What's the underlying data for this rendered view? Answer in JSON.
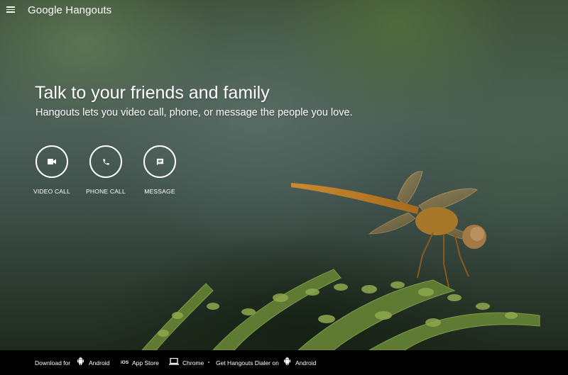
{
  "header": {
    "logo_google": "Google",
    "logo_product": "Hangouts"
  },
  "hero": {
    "title": "Talk to your friends and family",
    "subtitle": "Hangouts lets you video call, phone, or message the people you love."
  },
  "actions": [
    {
      "label": "VIDEO CALL",
      "icon": "videocam-icon"
    },
    {
      "label": "PHONE CALL",
      "icon": "phone-icon"
    },
    {
      "label": "MESSAGE",
      "icon": "message-icon"
    }
  ],
  "footer": {
    "download_for": "Download for",
    "android_label": "Android",
    "ios_badge": "iOS",
    "app_store_label": "App Store",
    "chrome_label": "Chrome",
    "dialer_text": "Get Hangouts Dialer on",
    "dialer_android_label": "Android"
  }
}
